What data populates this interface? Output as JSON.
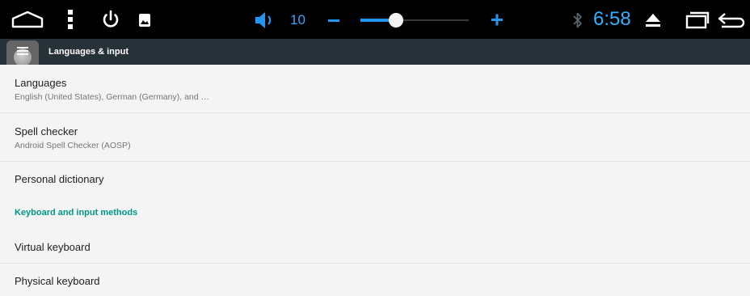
{
  "status_bar": {
    "icons": [
      "home-icon",
      "more-vert-icon",
      "power-icon",
      "image-icon",
      "volume-icon",
      "bluetooth-icon",
      "eject-icon",
      "recents-icon",
      "back-icon"
    ],
    "volume_level": "10",
    "volume_fraction": 0.33,
    "time": "6:58",
    "accent_color": "#2196f3"
  },
  "toolbar": {
    "title": "Languages & input",
    "background_color": "#263238"
  },
  "settings": {
    "languages": {
      "title": "Languages",
      "summary": "English (United States), German (Germany), and …"
    },
    "spell_checker": {
      "title": "Spell checker",
      "summary": "Android Spell Checker (AOSP)"
    },
    "personal_dictionary": {
      "title": "Personal dictionary"
    },
    "category_keyboard": {
      "title": "Keyboard and input methods",
      "color": "#009688"
    },
    "virtual_keyboard": {
      "title": "Virtual keyboard"
    },
    "physical_keyboard": {
      "title": "Physical keyboard"
    }
  }
}
